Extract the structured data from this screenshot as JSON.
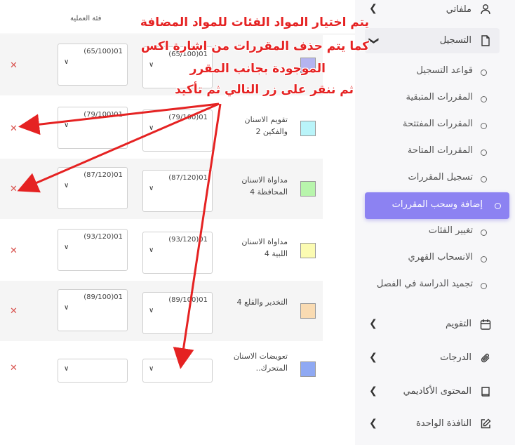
{
  "table": {
    "column_header": "فئة العملية",
    "rows": [
      {
        "name": "",
        "value1": "(65/100)01",
        "value2": "(65/100)01",
        "color": "#b4b4f0",
        "shade": true
      },
      {
        "name": "تقويم الاسنان والفكين 2",
        "value1": "(79/100)01",
        "value2": "(79/100)01",
        "color": "#b9f4f9",
        "shade": false
      },
      {
        "name": "مداواة الاسنان المحافظة 4",
        "value1": "(87/120)01",
        "value2": "(87/120)01",
        "color": "#b8f5ac",
        "shade": true
      },
      {
        "name": "مداواة الاسنان اللبية 4",
        "value1": "(93/120)01",
        "value2": "(93/120)01",
        "color": "#fbfbb2",
        "shade": false
      },
      {
        "name": "التخدير والقلع 4",
        "value1": "(89/100)01",
        "value2": "(89/100)01",
        "color": "#f9dbb2",
        "shade": true
      },
      {
        "name": "تعويضات الاسنان المتحرك..",
        "value1": "",
        "value2": "",
        "color": "#8fa9f3",
        "shade": false
      }
    ]
  },
  "sidebar": {
    "profile": "ملفاتي",
    "registration": "التسجيل",
    "sub_items": [
      "قواعد التسجيل",
      "المقررات المتبقية",
      "المقررات المفتتحة",
      "المقررات المتاحة",
      "تسجيل المقررات",
      "إضافة وسحب المقررات",
      "تغيير الفئات",
      "الانسحاب القهري",
      "تجميد الدراسة في الفصل"
    ],
    "calendar": "التقويم",
    "grades": "الدرجات",
    "academic_content": "المحتوى الأكاديمي",
    "one_window": "النافذة الواحدة"
  },
  "annotation": {
    "line1": "يتم اختيار المواد الفئات للمواد المضافة",
    "line2": "كما يتم حذف المقررات من اشارة اكس",
    "line3": "الموجودة بجانب المقرر",
    "line4": "ثم ننقر على زر التالي ثم تأكيد"
  },
  "colors": {
    "accent": "#8c82f2",
    "annotation": "#e52222",
    "remove": "#d9534f"
  }
}
